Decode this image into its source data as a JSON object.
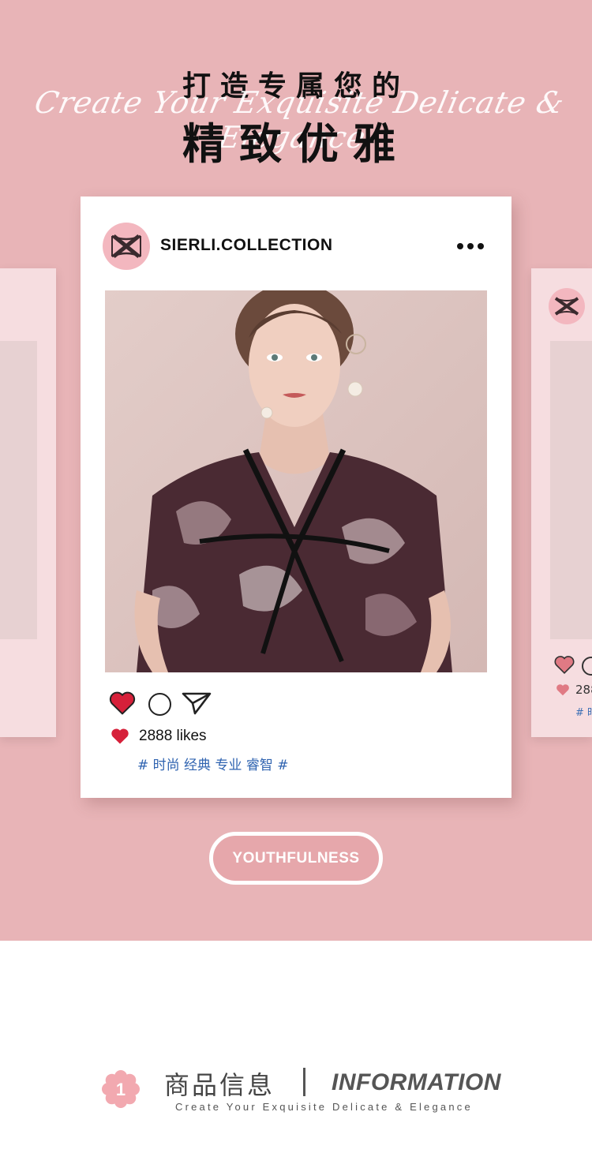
{
  "hero": {
    "title_line1": "打造专属您的",
    "script_overlay": "Create Your Exquisite Delicate & Elegance",
    "title_line2": "精致优雅",
    "background_color": "#e8b4b7"
  },
  "post": {
    "username": "SIERLI.COLLECTION",
    "likes_text": "2888 likes",
    "tags": "# 时尚 经典 专业 睿智 #",
    "liked": true,
    "accent_red": "#d6203a",
    "tag_color": "#2f63b0"
  },
  "side_card_right": {
    "likes_partial": "288",
    "tags_partial": "# 时"
  },
  "cta": {
    "label": "YOUTHFULNESS"
  },
  "info": {
    "badge_number": "1",
    "title_cn": "商品信息",
    "title_en": "INFORMATION",
    "subtitle": "Create Your Exquisite Delicate & Elegance"
  },
  "icons": [
    "logo-icon",
    "more-icon",
    "heart-icon",
    "comment-icon",
    "send-icon",
    "flower-badge-icon"
  ]
}
